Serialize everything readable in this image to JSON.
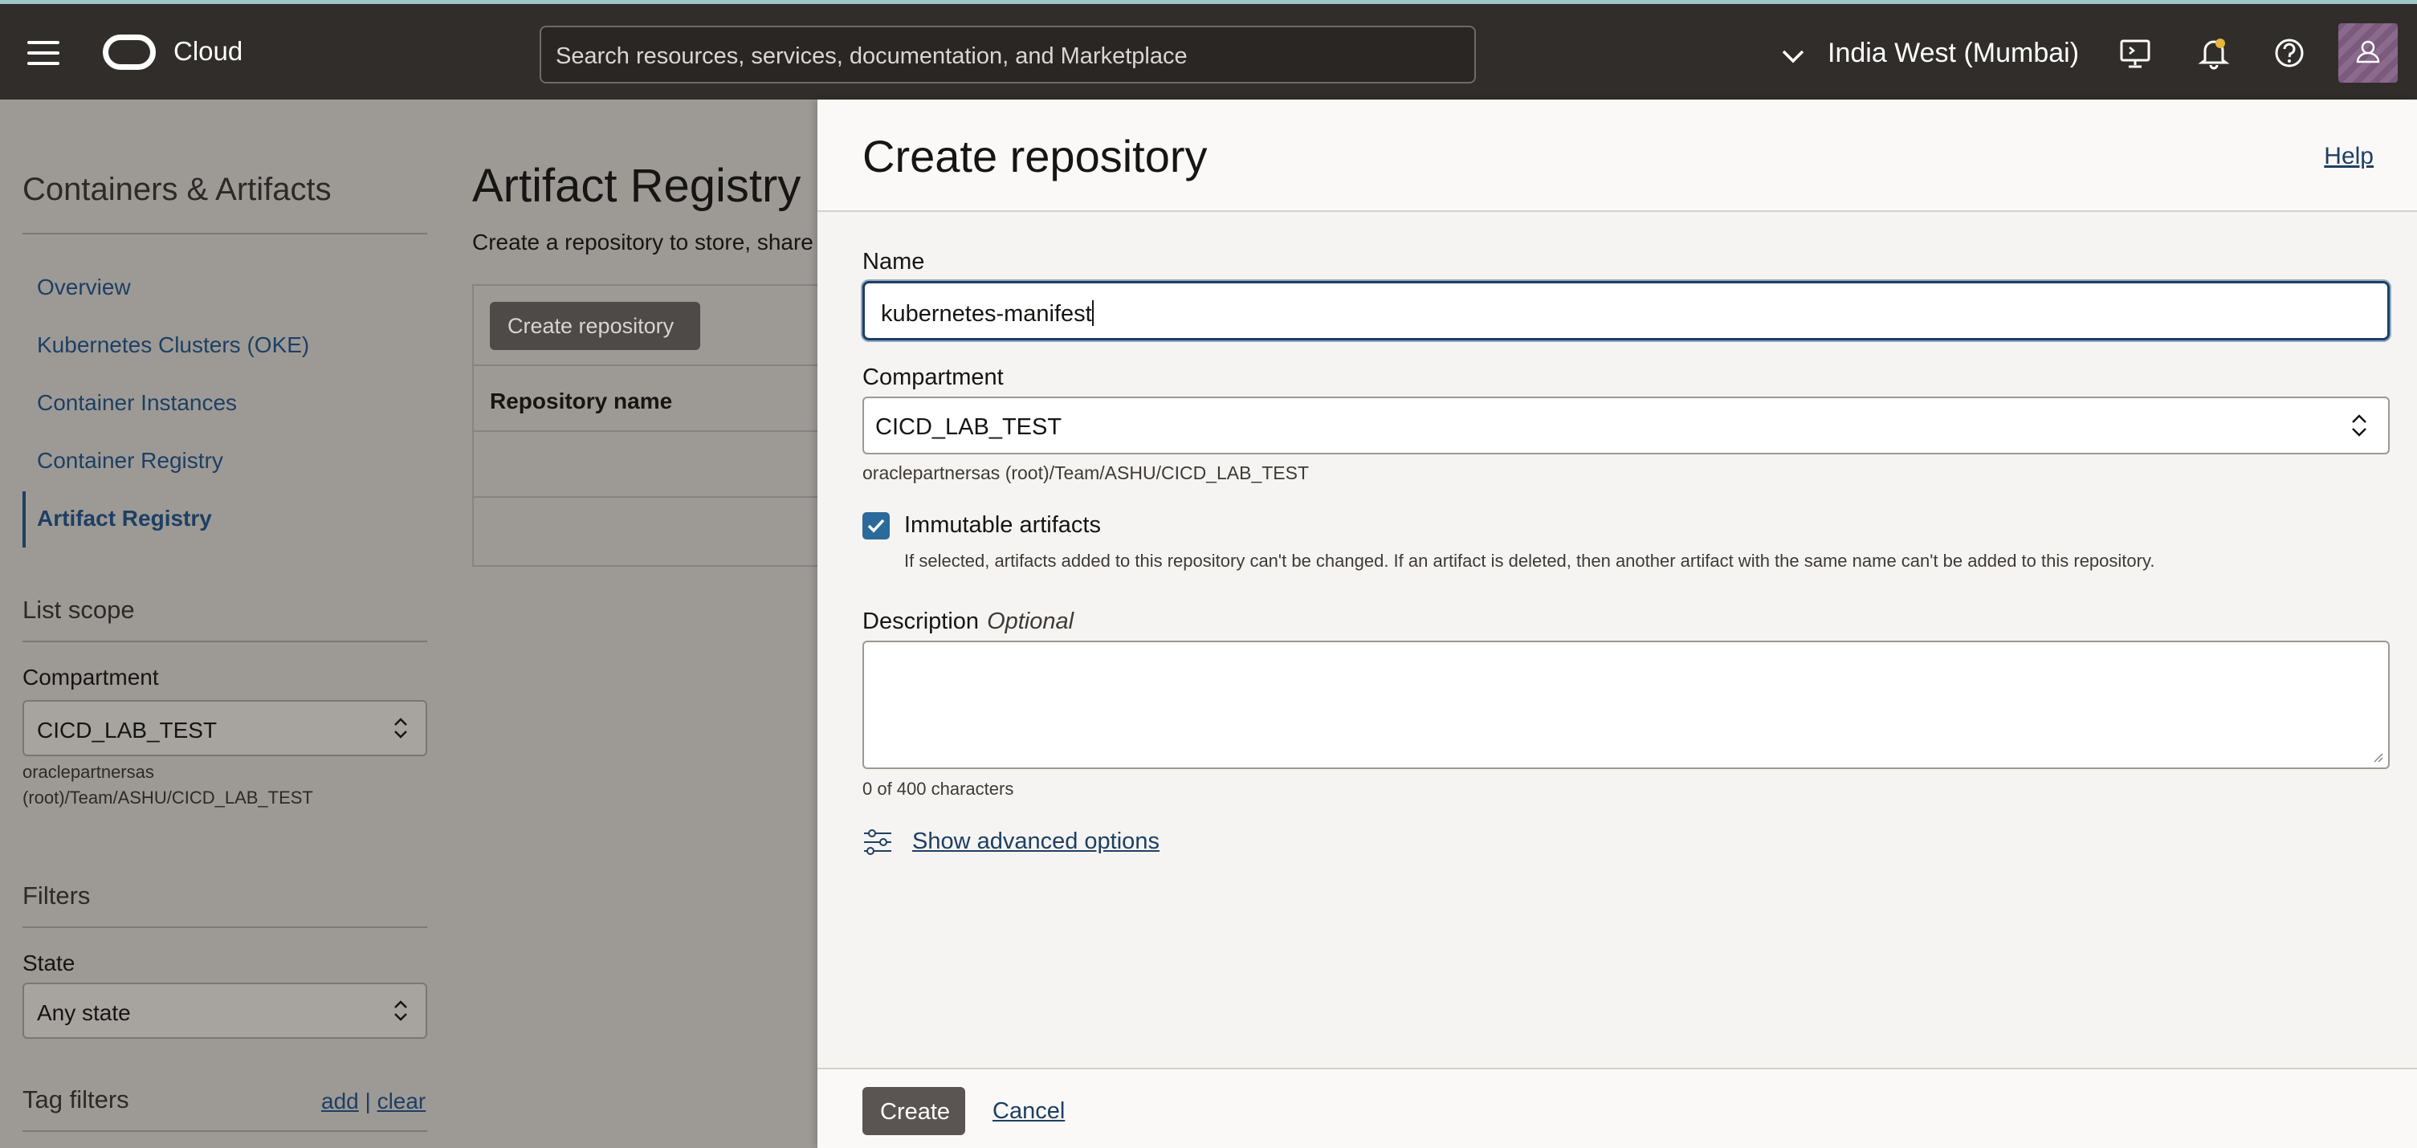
{
  "topbar": {
    "logo_text": "Cloud",
    "search_placeholder": "Search resources, services, documentation, and Marketplace",
    "region": "India West (Mumbai)"
  },
  "sidebar": {
    "title": "Containers & Artifacts",
    "items": [
      {
        "label": "Overview"
      },
      {
        "label": "Kubernetes Clusters (OKE)"
      },
      {
        "label": "Container Instances"
      },
      {
        "label": "Container Registry"
      },
      {
        "label": "Artifact Registry",
        "active": true
      }
    ],
    "list_scope": {
      "heading": "List scope",
      "compartment_label": "Compartment",
      "compartment_value": "CICD_LAB_TEST",
      "compartment_path": "oraclepartnersas (root)/Team/ASHU/CICD_LAB_TEST"
    },
    "filters": {
      "heading": "Filters",
      "state_label": "State",
      "state_value": "Any state"
    },
    "tag_filters": {
      "heading": "Tag filters",
      "add": "add",
      "sep": "|",
      "clear": "clear"
    }
  },
  "main": {
    "title": "Artifact Registry",
    "subtitle": "Create a repository to store, share",
    "create_button": "Create repository",
    "column_header": "Repository name"
  },
  "drawer": {
    "title": "Create repository",
    "help": "Help",
    "name_label": "Name",
    "name_value": "kubernetes-manifest",
    "compartment_label": "Compartment",
    "compartment_value": "CICD_LAB_TEST",
    "compartment_path": "oraclepartnersas (root)/Team/ASHU/CICD_LAB_TEST",
    "immutable_label": "Immutable artifacts",
    "immutable_checked": true,
    "immutable_help": "If selected, artifacts added to this repository can't be changed. If an artifact is deleted, then another artifact with the same name can't be added to this repository.",
    "description_label": "Description",
    "description_optional": "Optional",
    "description_value": "",
    "char_count": "0 of 400 characters",
    "advanced_link": "Show advanced options",
    "create_button": "Create",
    "cancel_link": "Cancel"
  },
  "colors": {
    "topbar_bg": "#312d2a",
    "link": "#1e3f62",
    "checkbox": "#2b6a9b",
    "primary_button": "#5a5552"
  }
}
